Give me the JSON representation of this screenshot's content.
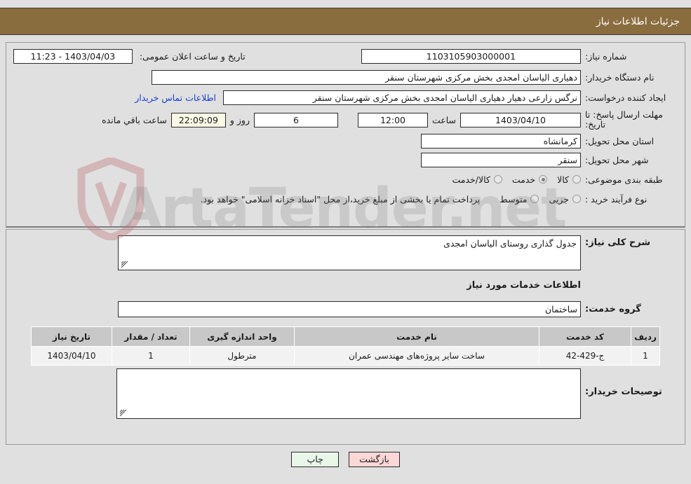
{
  "header": {
    "title": "جزئیات اطلاعات نیاز",
    "bg_color": "#8a6d3f",
    "text_color": "#ffffff"
  },
  "watermark": {
    "text": "ArtaTender.net"
  },
  "form": {
    "need_number_label": "شماره نیاز:",
    "need_number_value": "1103105903000001",
    "announce_datetime_label": "تاریخ و ساعت اعلان عمومی:",
    "announce_datetime_value": "1403/04/03 - 11:23",
    "buyer_org_label": "نام دستگاه خریدار:",
    "buyer_org_value": "دهیاری الیاسان امجدی بخش مرکزی شهرستان سنقر",
    "creator_label": "ایجاد کننده درخواست:",
    "creator_value": "نرگس زارعی دهیار دهیاری الیاسان امجدی بخش مرکزی شهرستان سنقر",
    "buyer_contact_link": "اطلاعات تماس خریدار",
    "deadline_label": "مهلت ارسال پاسخ: تا تاریخ:",
    "deadline_date": "1403/04/10",
    "hour_label": "ساعت",
    "deadline_time": "12:00",
    "remaining_days": "6",
    "days_and_label": "روز و",
    "remaining_clock": "22:09:09",
    "remaining_suffix": "ساعت باقي مانده",
    "province_label": "استان محل تحویل:",
    "province_value": "کرمانشاه",
    "city_label": "شهر محل تحویل:",
    "city_value": "سنقر",
    "category_label": "طبقه بندی موضوعی:",
    "category_options": [
      {
        "label": "کالا",
        "selected": false
      },
      {
        "label": "خدمت",
        "selected": true
      },
      {
        "label": "کالا/خدمت",
        "selected": false
      }
    ],
    "process_label": "نوع فرآیند خرید :",
    "process_options": [
      {
        "label": "جزیی",
        "selected": false
      },
      {
        "label": "متوسط",
        "selected": false
      }
    ],
    "process_note": "پرداخت تمام یا بخشی از مبلغ خرید،از محل \"اسناد خزانه اسلامی\" خواهد بود."
  },
  "details": {
    "overall_desc_label": "شرح کلی نیاز:",
    "overall_desc_value": "جدول گذاری روستای الیاسان امجدی",
    "services_section_title": "اطلاعات خدمات مورد نیاز",
    "service_group_label": "گروه خدمت:",
    "service_group_value": "ساختمان",
    "buyer_notes_label": "توصیحات خریدار:",
    "buyer_notes_value": ""
  },
  "table": {
    "columns": [
      "ردیف",
      "کد خدمت",
      "نام خدمت",
      "واحد اندازه گیری",
      "تعداد / مقدار",
      "تاریخ نیاز"
    ],
    "rows": [
      {
        "row_no": "1",
        "service_code": "ج-429-42",
        "service_name": "ساخت سایر پروژه‌های مهندسی عمران",
        "unit": "مترطول",
        "quantity": "1",
        "need_date": "1403/04/10"
      }
    ]
  },
  "buttons": {
    "print_label": "چاپ",
    "back_label": "بازگشت"
  }
}
